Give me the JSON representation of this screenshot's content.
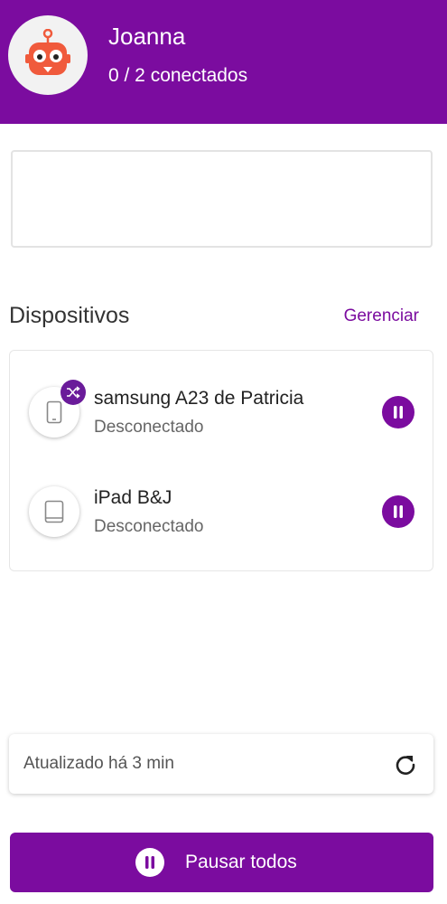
{
  "header": {
    "name": "Joanna",
    "subtitle": "0 / 2 conectados",
    "avatar_icon": "robot-icon",
    "background": "#7b0c9f"
  },
  "devices_section": {
    "title": "Dispositivos",
    "manage_label": "Gerenciar"
  },
  "devices": [
    {
      "name": "samsung A23 de Patricia",
      "status": "Desconectado",
      "icon": "phone-icon",
      "badge_icon": "shuffle-icon"
    },
    {
      "name": "iPad B&J",
      "status": "Desconectado",
      "icon": "tablet-icon"
    }
  ],
  "footer": {
    "updated_text": "Atualizado há 3 min",
    "pause_all_label": "Pausar todos"
  },
  "colors": {
    "accent": "#7b0c9f",
    "avatar_robot": "#f05a3c"
  }
}
